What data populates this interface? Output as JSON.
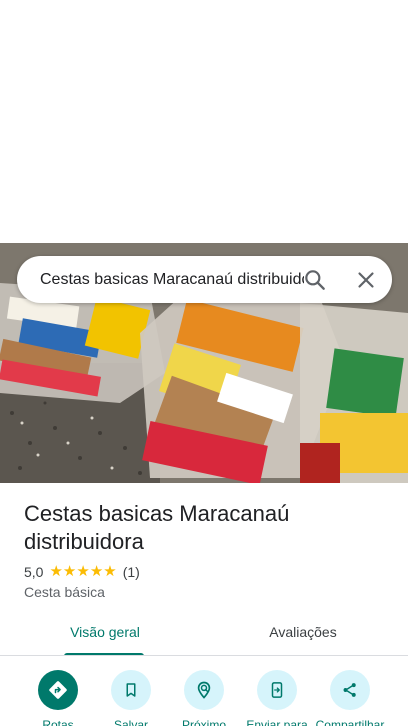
{
  "search": {
    "query": "Cestas basicas Maracanaú distribuidora"
  },
  "place": {
    "name": "Cestas basicas Maracanaú distribuidora",
    "rating": "5,0",
    "stars": 5,
    "review_count": "(1)",
    "category": "Cesta básica"
  },
  "tabs": [
    {
      "label": "Visão geral",
      "active": true
    },
    {
      "label": "Avaliações",
      "active": false
    }
  ],
  "actions": [
    {
      "label": "Rotas",
      "icon": "directions-icon"
    },
    {
      "label": "Salvar",
      "icon": "bookmark-icon"
    },
    {
      "label": "Próximo",
      "icon": "nearby-icon"
    },
    {
      "label": "Enviar para",
      "icon": "send-to-phone-icon"
    },
    {
      "label": "Compartilhar",
      "icon": "share-icon"
    }
  ],
  "colors": {
    "accent": "#00796b",
    "action_bg": "#d6f4fb",
    "star": "#fbbc04"
  }
}
